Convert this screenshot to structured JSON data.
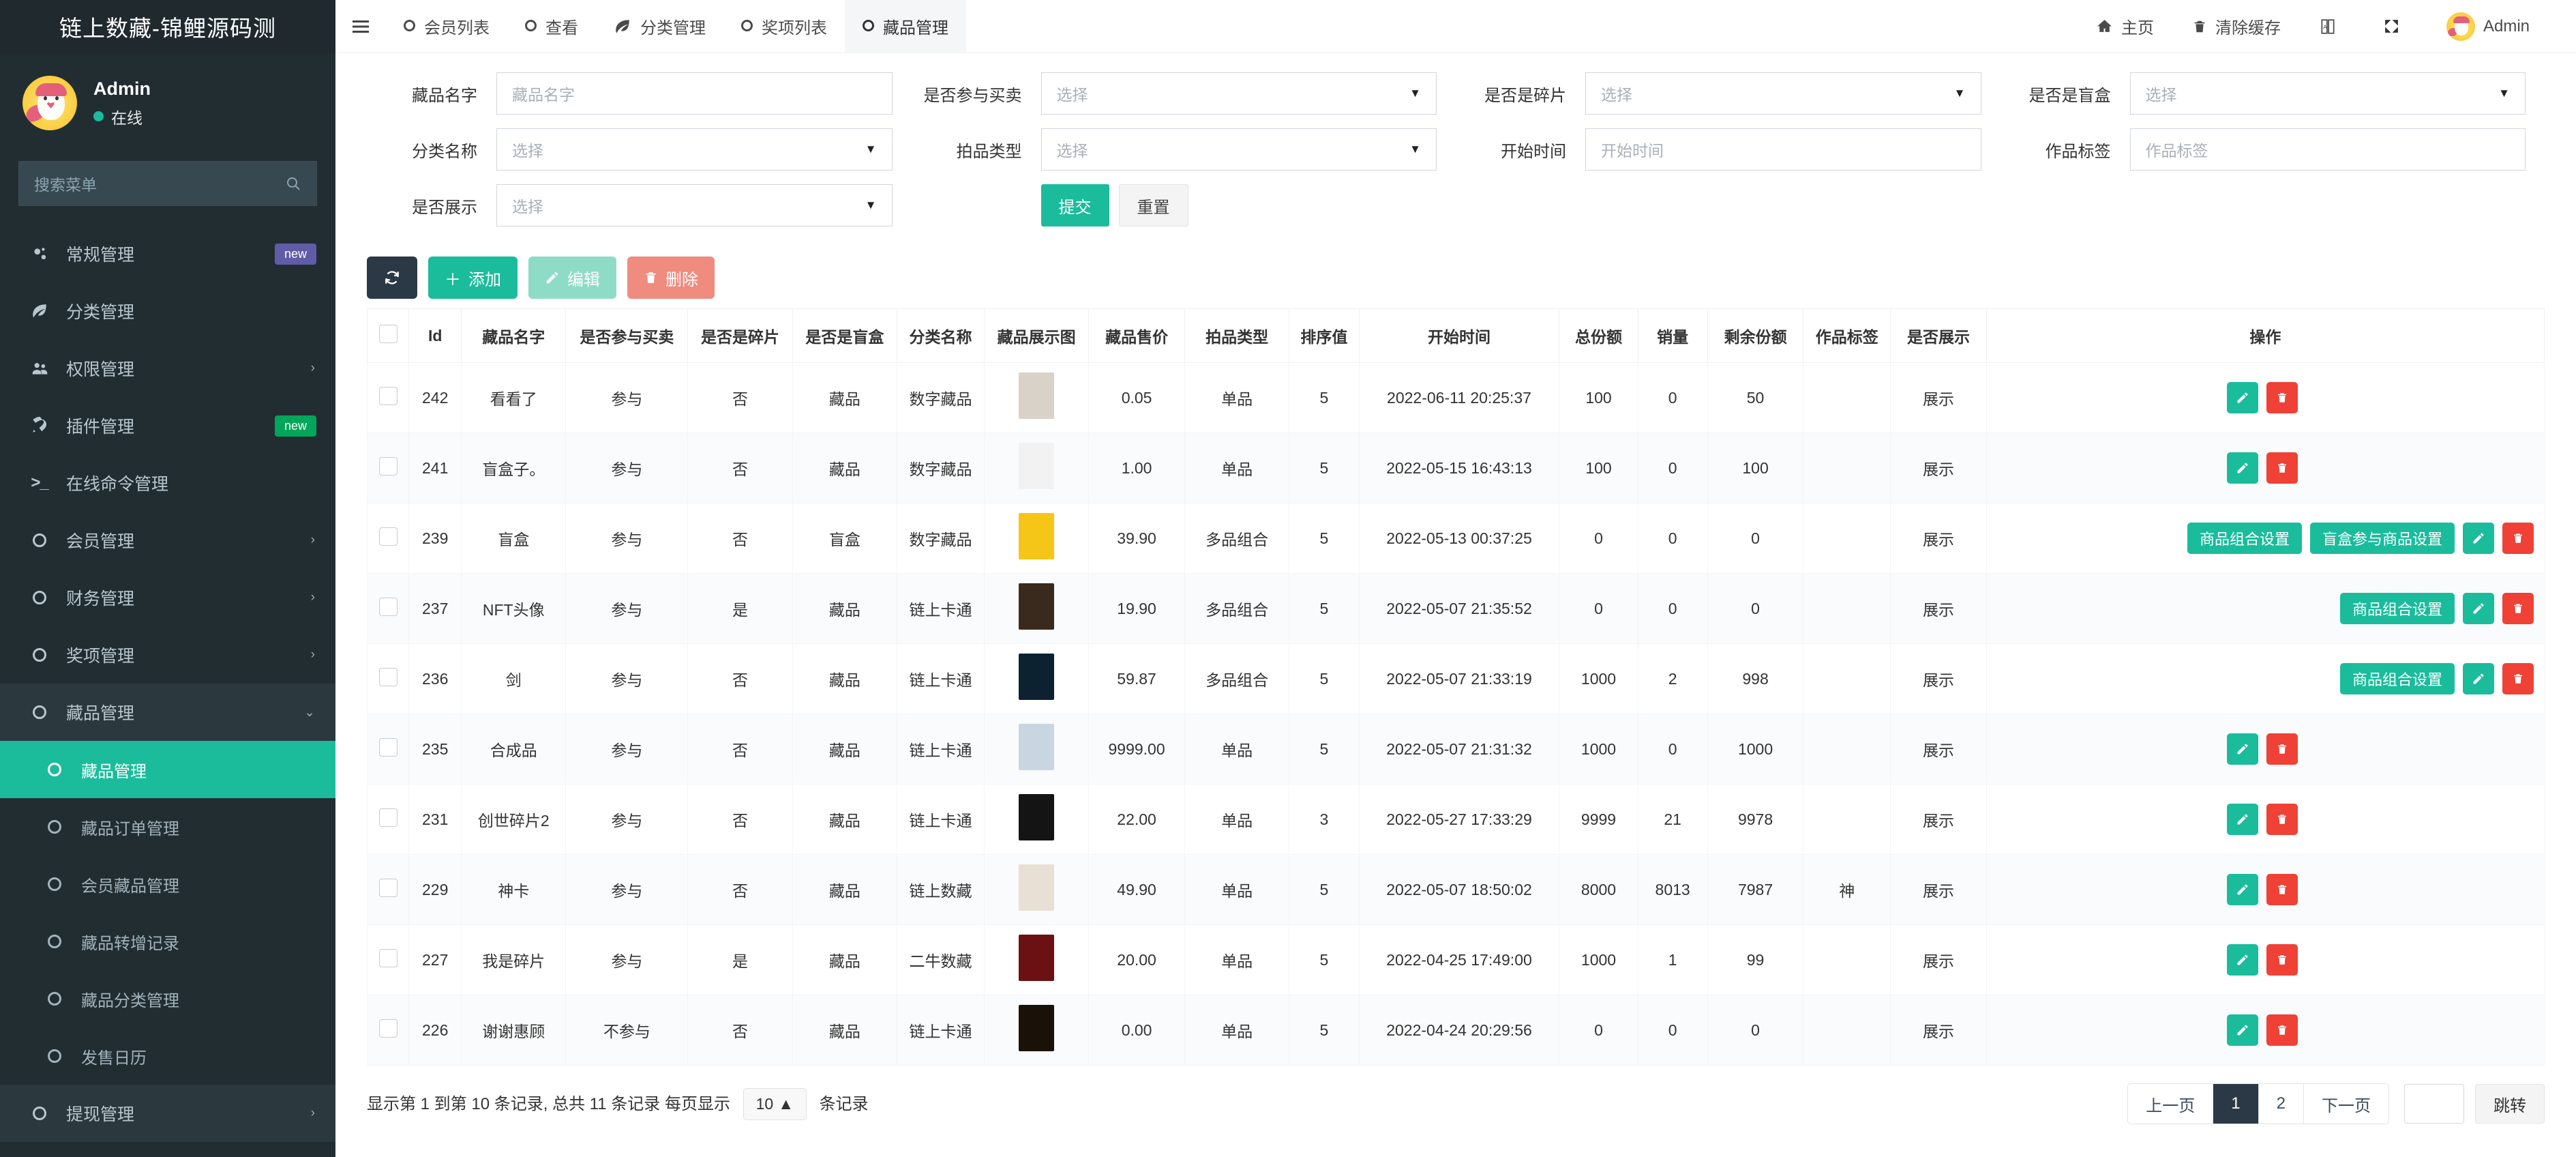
{
  "brand": {
    "title": "链上数藏-锦鲤源码测"
  },
  "user": {
    "name": "Admin",
    "status": "在线"
  },
  "sidebar": {
    "search_placeholder": "搜索菜单",
    "items": [
      {
        "label": "常规管理",
        "icon": "gears-icon",
        "badge": "new",
        "badge_color": "purple",
        "caret": "",
        "level": "top",
        "state": "normal"
      },
      {
        "label": "分类管理",
        "icon": "leaf-icon",
        "badge": "",
        "badge_color": "",
        "caret": "",
        "level": "top",
        "state": "normal"
      },
      {
        "label": "权限管理",
        "icon": "users-icon",
        "badge": "",
        "badge_color": "",
        "caret": "›",
        "level": "top",
        "state": "normal"
      },
      {
        "label": "插件管理",
        "icon": "rocket-icon",
        "badge": "new",
        "badge_color": "green",
        "caret": "",
        "level": "top",
        "state": "normal"
      },
      {
        "label": "在线命令管理",
        "icon": "terminal-icon",
        "badge": "",
        "badge_color": "",
        "caret": "",
        "level": "top",
        "state": "normal"
      },
      {
        "label": "会员管理",
        "icon": "ring-icon",
        "badge": "",
        "badge_color": "",
        "caret": "›",
        "level": "top",
        "state": "normal"
      },
      {
        "label": "财务管理",
        "icon": "ring-icon",
        "badge": "",
        "badge_color": "",
        "caret": "›",
        "level": "top",
        "state": "normal"
      },
      {
        "label": "奖项管理",
        "icon": "ring-icon",
        "badge": "",
        "badge_color": "",
        "caret": "›",
        "level": "top",
        "state": "normal"
      },
      {
        "label": "藏品管理",
        "icon": "ring-icon",
        "badge": "",
        "badge_color": "",
        "caret": "⌄",
        "level": "top",
        "state": "open"
      },
      {
        "label": "藏品管理",
        "icon": "ring-icon",
        "badge": "",
        "badge_color": "",
        "caret": "",
        "level": "sub",
        "state": "active"
      },
      {
        "label": "藏品订单管理",
        "icon": "ring-icon",
        "badge": "",
        "badge_color": "",
        "caret": "",
        "level": "sub",
        "state": "normal"
      },
      {
        "label": "会员藏品管理",
        "icon": "ring-icon",
        "badge": "",
        "badge_color": "",
        "caret": "",
        "level": "sub",
        "state": "normal"
      },
      {
        "label": "藏品转增记录",
        "icon": "ring-icon",
        "badge": "",
        "badge_color": "",
        "caret": "",
        "level": "sub",
        "state": "normal"
      },
      {
        "label": "藏品分类管理",
        "icon": "ring-icon",
        "badge": "",
        "badge_color": "",
        "caret": "",
        "level": "sub",
        "state": "normal"
      },
      {
        "label": "发售日历",
        "icon": "ring-icon",
        "badge": "",
        "badge_color": "",
        "caret": "",
        "level": "sub",
        "state": "normal"
      },
      {
        "label": "提现管理",
        "icon": "ring-icon",
        "badge": "",
        "badge_color": "",
        "caret": "›",
        "level": "top",
        "state": "hover"
      }
    ]
  },
  "topnav": {
    "menu_icon": "hamburger-icon",
    "tabs": [
      {
        "label": "会员列表",
        "icon": "ring-icon",
        "active": false
      },
      {
        "label": "查看",
        "icon": "ring-icon",
        "active": false
      },
      {
        "label": "分类管理",
        "icon": "leaf-icon",
        "active": false
      },
      {
        "label": "奖项列表",
        "icon": "ring-icon",
        "active": false
      },
      {
        "label": "藏品管理",
        "icon": "ring-icon",
        "active": true
      }
    ],
    "right": [
      {
        "label": "主页",
        "icon": "home-icon"
      },
      {
        "label": "清除缓存",
        "icon": "trash-icon"
      },
      {
        "label": "",
        "icon": "language-icon"
      },
      {
        "label": "",
        "icon": "fullscreen-icon"
      },
      {
        "label": "Admin",
        "icon": "avatar-icon"
      }
    ]
  },
  "filters": {
    "rows": [
      [
        {
          "label": "藏品名字",
          "type": "input",
          "value": "",
          "placeholder": "藏品名字"
        },
        {
          "label": "是否参与买卖",
          "type": "select",
          "value": "选择",
          "placeholder": ""
        },
        {
          "label": "是否是碎片",
          "type": "select",
          "value": "选择",
          "placeholder": ""
        },
        {
          "label": "是否是盲盒",
          "type": "select",
          "value": "选择",
          "placeholder": ""
        }
      ],
      [
        {
          "label": "分类名称",
          "type": "select",
          "value": "选择",
          "placeholder": ""
        },
        {
          "label": "拍品类型",
          "type": "select",
          "value": "选择",
          "placeholder": ""
        },
        {
          "label": "开始时间",
          "type": "input",
          "value": "",
          "placeholder": "开始时间"
        },
        {
          "label": "作品标签",
          "type": "input",
          "value": "",
          "placeholder": "作品标签"
        }
      ],
      [
        {
          "label": "是否展示",
          "type": "select",
          "value": "选择",
          "placeholder": ""
        }
      ]
    ],
    "submit_label": "提交",
    "reset_label": "重置"
  },
  "toolbar": {
    "refresh_icon": "refresh-icon",
    "add_label": "添加",
    "edit_label": "编辑",
    "delete_label": "删除"
  },
  "table": {
    "columns": [
      "",
      "Id",
      "藏品名字",
      "是否参与买卖",
      "是否是碎片",
      "是否是盲盒",
      "分类名称",
      "藏品展示图",
      "藏品售价",
      "拍品类型",
      "排序值",
      "开始时间",
      "总份额",
      "销量",
      "剩余份额",
      "作品标签",
      "是否展示",
      "操作"
    ],
    "rows": [
      {
        "id": "242",
        "name": "看看了",
        "trade": "参与",
        "fragment": "否",
        "blindbox": "藏品",
        "category": "数字藏品",
        "thumb": "#d9d2c8",
        "price": "0.05",
        "auction_type": "单品",
        "sort": "5",
        "start_time": "2022-06-11 20:25:37",
        "total": "100",
        "sold": "0",
        "remain": "50",
        "tag": "",
        "display": "展示",
        "trade_link": true,
        "fragment_link": false,
        "blindbox_link": false,
        "auction_link": false,
        "extra_buttons": []
      },
      {
        "id": "241",
        "name": "盲盒子。",
        "trade": "参与",
        "fragment": "否",
        "blindbox": "藏品",
        "category": "数字藏品",
        "thumb": "#f2f2f2",
        "price": "1.00",
        "auction_type": "单品",
        "sort": "5",
        "start_time": "2022-05-15 16:43:13",
        "total": "100",
        "sold": "0",
        "remain": "100",
        "tag": "",
        "display": "展示",
        "trade_link": true,
        "fragment_link": false,
        "blindbox_link": false,
        "auction_link": false,
        "extra_buttons": []
      },
      {
        "id": "239",
        "name": "盲盒",
        "trade": "参与",
        "fragment": "否",
        "blindbox": "盲盒",
        "category": "数字藏品",
        "thumb": "#f5c518",
        "price": "39.90",
        "auction_type": "多品组合",
        "sort": "5",
        "start_time": "2022-05-13 00:37:25",
        "total": "0",
        "sold": "0",
        "remain": "0",
        "tag": "",
        "display": "展示",
        "trade_link": true,
        "fragment_link": false,
        "blindbox_link": true,
        "auction_link": true,
        "extra_buttons": [
          "商品组合设置",
          "盲盒参与商品设置"
        ]
      },
      {
        "id": "237",
        "name": "NFT头像",
        "trade": "参与",
        "fragment": "是",
        "blindbox": "藏品",
        "category": "链上卡通",
        "thumb": "#3a2a1e",
        "price": "19.90",
        "auction_type": "多品组合",
        "sort": "5",
        "start_time": "2022-05-07 21:35:52",
        "total": "0",
        "sold": "0",
        "remain": "0",
        "tag": "",
        "display": "展示",
        "trade_link": true,
        "fragment_link": true,
        "blindbox_link": false,
        "auction_link": true,
        "extra_buttons": [
          "商品组合设置"
        ]
      },
      {
        "id": "236",
        "name": "剑",
        "trade": "参与",
        "fragment": "否",
        "blindbox": "藏品",
        "category": "链上卡通",
        "thumb": "#0c2230",
        "price": "59.87",
        "auction_type": "多品组合",
        "sort": "5",
        "start_time": "2022-05-07 21:33:19",
        "total": "1000",
        "sold": "2",
        "remain": "998",
        "tag": "",
        "display": "展示",
        "trade_link": true,
        "fragment_link": false,
        "blindbox_link": false,
        "auction_link": true,
        "extra_buttons": [
          "商品组合设置"
        ]
      },
      {
        "id": "235",
        "name": "合成品",
        "trade": "参与",
        "fragment": "否",
        "blindbox": "藏品",
        "category": "链上卡通",
        "thumb": "#c9d6e2",
        "price": "9999.00",
        "auction_type": "单品",
        "sort": "5",
        "start_time": "2022-05-07 21:31:32",
        "total": "1000",
        "sold": "0",
        "remain": "1000",
        "tag": "",
        "display": "展示",
        "trade_link": true,
        "fragment_link": false,
        "blindbox_link": false,
        "auction_link": false,
        "extra_buttons": []
      },
      {
        "id": "231",
        "name": "创世碎片2",
        "trade": "参与",
        "fragment": "否",
        "blindbox": "藏品",
        "category": "链上卡通",
        "thumb": "#141414",
        "price": "22.00",
        "auction_type": "单品",
        "sort": "3",
        "start_time": "2022-05-27 17:33:29",
        "total": "9999",
        "sold": "21",
        "remain": "9978",
        "tag": "",
        "display": "展示",
        "trade_link": true,
        "fragment_link": false,
        "blindbox_link": false,
        "auction_link": false,
        "extra_buttons": []
      },
      {
        "id": "229",
        "name": "神卡",
        "trade": "参与",
        "fragment": "否",
        "blindbox": "藏品",
        "category": "链上数藏",
        "thumb": "#e8e0d4",
        "price": "49.90",
        "auction_type": "单品",
        "sort": "5",
        "start_time": "2022-05-07 18:50:02",
        "total": "8000",
        "sold": "8013",
        "remain": "7987",
        "tag": "神",
        "display": "展示",
        "trade_link": true,
        "fragment_link": false,
        "blindbox_link": false,
        "auction_link": false,
        "extra_buttons": []
      },
      {
        "id": "227",
        "name": "我是碎片",
        "trade": "参与",
        "fragment": "是",
        "blindbox": "藏品",
        "category": "二牛数藏",
        "thumb": "#6b1114",
        "price": "20.00",
        "auction_type": "单品",
        "sort": "5",
        "start_time": "2022-04-25 17:49:00",
        "total": "1000",
        "sold": "1",
        "remain": "99",
        "tag": "",
        "display": "展示",
        "trade_link": true,
        "fragment_link": true,
        "blindbox_link": false,
        "auction_link": false,
        "extra_buttons": []
      },
      {
        "id": "226",
        "name": "谢谢惠顾",
        "trade": "不参与",
        "fragment": "否",
        "blindbox": "藏品",
        "category": "链上卡通",
        "thumb": "#1a1208",
        "price": "0.00",
        "auction_type": "单品",
        "sort": "5",
        "start_time": "2022-04-24 20:29:56",
        "total": "0",
        "sold": "0",
        "remain": "0",
        "tag": "",
        "display": "展示",
        "trade_link": false,
        "fragment_link": false,
        "blindbox_link": false,
        "auction_link": false,
        "extra_buttons": []
      }
    ]
  },
  "footer": {
    "summary_prefix": "显示第 1 到第 10 条记录, 总共 11 条记录 每页显示",
    "page_size": "10",
    "summary_suffix": "条记录",
    "prev_label": "上一页",
    "pages": [
      "1",
      "2"
    ],
    "active_page": "1",
    "next_label": "下一页",
    "jump_value": "",
    "jump_label": "跳转"
  },
  "colors": {
    "accent": "#1abc9c",
    "sidebar": "#222d32",
    "danger": "#ef4136",
    "dark": "#2b3947"
  }
}
